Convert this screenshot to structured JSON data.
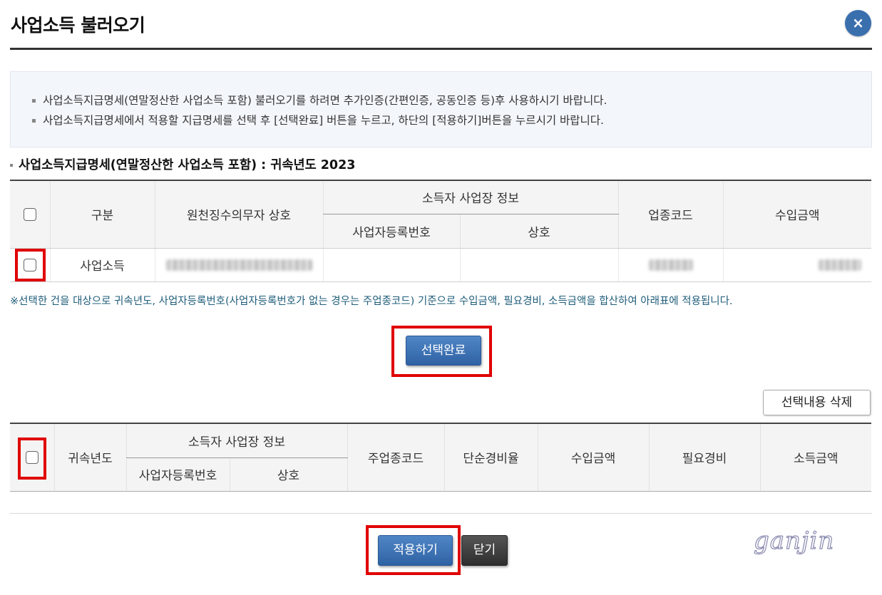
{
  "dialog": {
    "title": "사업소득 불러오기",
    "close_icon": "×"
  },
  "info": {
    "line1": "사업소득지급명세(연말정산한 사업소득 포함) 불러오기를 하려면 추가인증(간편인증, 공동인증 등)후 사용하시기 바랍니다.",
    "line2": "사업소득지급명세에서 적용할 지급명세를 선택 후 [선택완료] 버튼을 누르고, 하단의 [적용하기]버튼을 누르시기 바랍니다."
  },
  "section1": {
    "title": "사업소득지급명세(연말정산한 사업소득 포함) : 귀속년도 2023"
  },
  "table1": {
    "headers": {
      "category": "구분",
      "withholder_name": "원천징수의무자 상호",
      "group": "소득자 사업장 정보",
      "biz_reg_no": "사업자등록번호",
      "biz_name": "상호",
      "industry_code": "업종코드",
      "income": "수입금액"
    },
    "rows": [
      {
        "category": "사업소득"
      }
    ]
  },
  "notice": "※선택한 건을 대상으로 귀속년도, 사업자등록번호(사업자등록번호가 없는 경우는 주업종코드) 기준으로 수입금액, 필요경비, 소득금액을 합산하여 아래표에 적용됩니다.",
  "buttons": {
    "select_done": "선택완료",
    "delete_selected": "선택내용 삭제",
    "apply": "적용하기",
    "close": "닫기"
  },
  "table2": {
    "headers": {
      "year": "귀속년도",
      "group": "소득자 사업장 정보",
      "biz_reg_no": "사업자등록번호",
      "biz_name": "상호",
      "main_industry_code": "주업종코드",
      "simple_expense_rate": "단순경비율",
      "income": "수입금액",
      "necessary_expense": "필요경비",
      "income_amount": "소득금액"
    }
  },
  "watermark": "ganjin",
  "colors": {
    "primary_button": "#3a6fae",
    "highlight_red": "#e00000",
    "notice_text": "#1f5d7a",
    "info_bg": "#f3f6fb"
  }
}
